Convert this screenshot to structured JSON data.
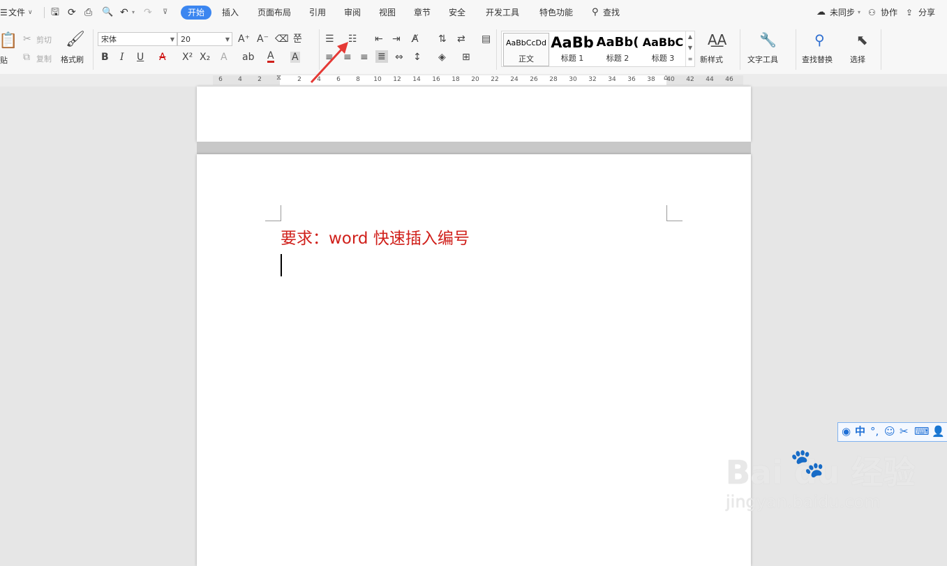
{
  "menu": {
    "file": "文件",
    "tabs": [
      "开始",
      "插入",
      "页面布局",
      "引用",
      "审阅",
      "视图",
      "章节",
      "安全",
      "开发工具",
      "特色功能"
    ],
    "search": "查找",
    "sync": "未同步",
    "collab": "协作",
    "share": "分享"
  },
  "ribbon": {
    "paste": "贴",
    "cut": "剪切",
    "copy": "复制",
    "format_painter": "格式刷",
    "font_name": "宋体",
    "font_size": "20",
    "styles": [
      {
        "preview": "AaBbCcDd",
        "name": "正文"
      },
      {
        "preview": "AaBb",
        "name": "标题 1"
      },
      {
        "preview": "AaBb(",
        "name": "标题 2"
      },
      {
        "preview": "AaBbC",
        "name": "标题 3"
      }
    ],
    "new_style": "新样式",
    "text_tools": "文字工具",
    "find_replace": "查找替换",
    "select": "选择"
  },
  "ruler": {
    "left_numbers": [
      "6",
      "4",
      "2"
    ],
    "right_numbers": [
      "2",
      "4",
      "6",
      "8",
      "10",
      "12",
      "14",
      "16",
      "18",
      "20",
      "22",
      "24",
      "26",
      "28",
      "30",
      "32",
      "34",
      "36",
      "38",
      "40",
      "42",
      "44",
      "46"
    ]
  },
  "document": {
    "title_line": "要求：word 快速插入编号"
  },
  "ime": {
    "lang": "中"
  },
  "watermark": {
    "brand": "Bai du",
    "cn": "经验",
    "url": "jingyan.baidu.com"
  },
  "colors": {
    "accent": "#3b86f0",
    "title_red": "#d0201b",
    "arrow_red": "#e53935"
  }
}
